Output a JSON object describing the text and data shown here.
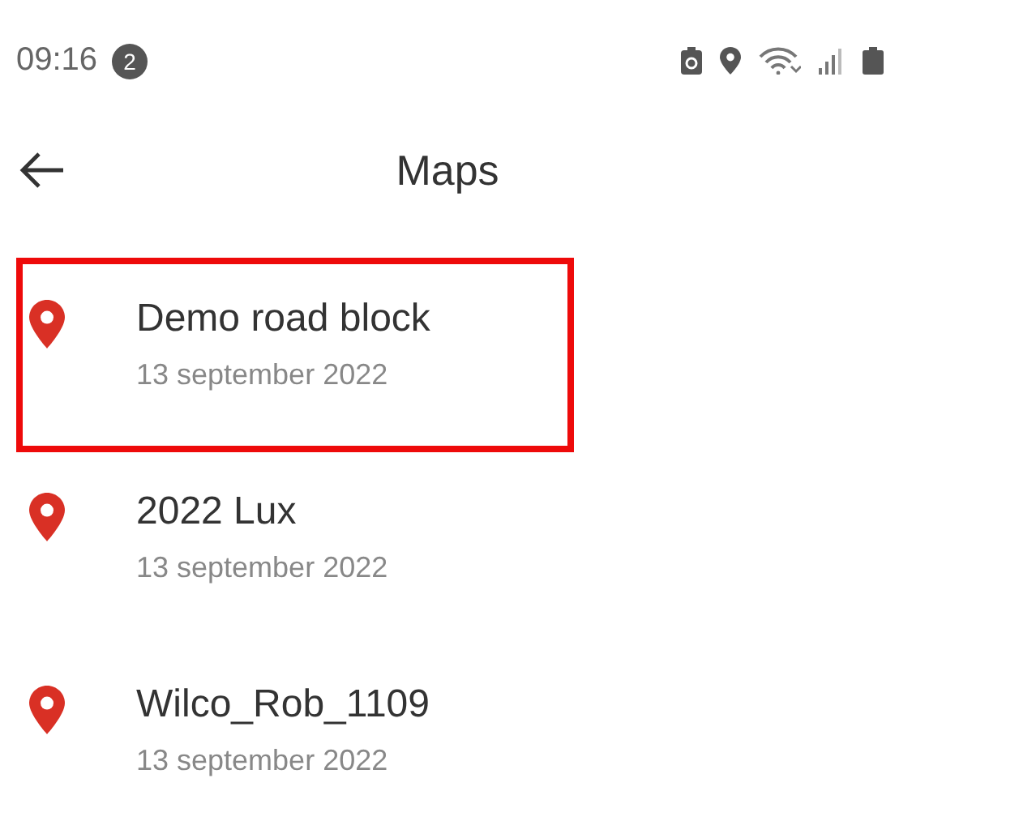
{
  "status_bar": {
    "time": "09:16",
    "notification_count": "2"
  },
  "header": {
    "title": "Maps"
  },
  "maps": [
    {
      "name": "Demo road block",
      "date": "13 september 2022",
      "highlighted": true
    },
    {
      "name": "2022 Lux",
      "date": "13 september 2022",
      "highlighted": false
    },
    {
      "name": "Wilco_Rob_1109",
      "date": "13 september 2022",
      "highlighted": false
    }
  ]
}
